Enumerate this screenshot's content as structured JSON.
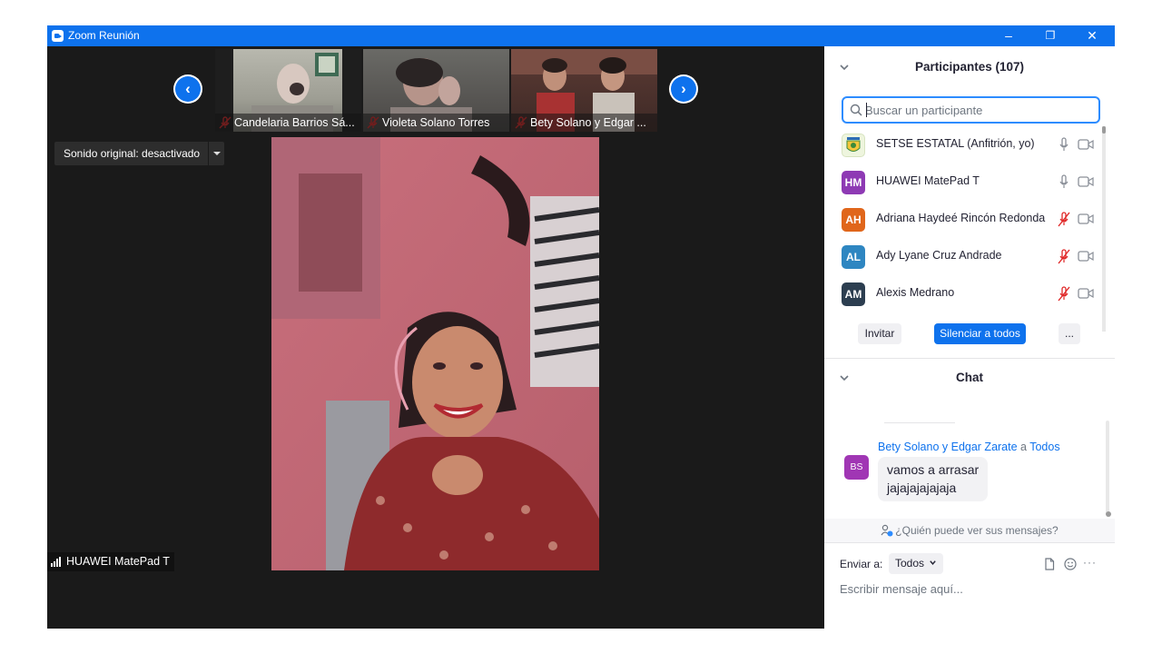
{
  "window": {
    "title": "Zoom Reunión",
    "controls": {
      "minimize": "–",
      "restore": "❐",
      "close": "✕"
    }
  },
  "gallery": {
    "prev_arrow": "‹",
    "next_arrow": "›",
    "thumbnails": [
      {
        "label": "Candelaria Barrios Sá...",
        "muted": true
      },
      {
        "label": "Violeta Solano Torres",
        "muted": true
      },
      {
        "label": "Bety Solano y Edgar ...",
        "muted": true
      }
    ]
  },
  "video": {
    "sound_toggle": "Sonido original: desactivado",
    "active_speaker_name": "HUAWEI MatePad T"
  },
  "participants": {
    "title": "Participantes (107)",
    "search_placeholder": "Buscar un participante",
    "list": [
      {
        "initials": "",
        "name": "SETSE ESTATAL (Anfitrión, yo)",
        "avatar_color": "#e9f3d6",
        "mic": "on"
      },
      {
        "initials": "HM",
        "name": "HUAWEI MatePad T",
        "avatar_color": "#8e3ab4",
        "mic": "on"
      },
      {
        "initials": "AH",
        "name": "Adriana Haydeé Rincón Redonda",
        "avatar_color": "#e0661b",
        "mic": "muted"
      },
      {
        "initials": "AL",
        "name": "Ady Lyane Cruz Andrade",
        "avatar_color": "#2e86c1",
        "mic": "muted"
      },
      {
        "initials": "AM",
        "name": "Alexis Medrano",
        "avatar_color": "#2c3e50",
        "mic": "muted"
      }
    ],
    "buttons": {
      "invite": "Invitar",
      "mute_all": "Silenciar a todos",
      "more": "..."
    }
  },
  "chat": {
    "title": "Chat",
    "messages": [
      {
        "from": "Bety Solano y Edgar Zarate",
        "connector": " a ",
        "to": "Todos",
        "initials": "BS",
        "lines": [
          "vamos a arrasar",
          "jajajajajajaja"
        ]
      }
    ],
    "who_can_see": "¿Quién puede ver sus mensajes?",
    "send_to_label": "Enviar a:",
    "send_to_value": "Todos",
    "input_placeholder": "Escribir mensaje aquí...",
    "more_icon": "···"
  },
  "colors": {
    "accent": "#0e72ed",
    "title_bar": "#0e72ed",
    "muted_red": "#e02828",
    "video_bg": "#1a1a1a"
  }
}
